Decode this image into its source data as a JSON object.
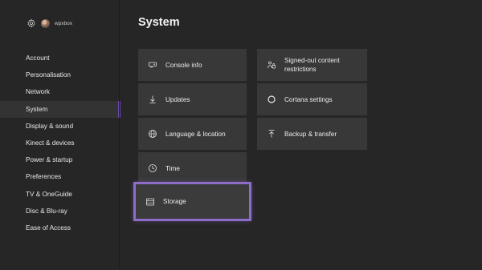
{
  "profile": {
    "gamertag": "wpxbox"
  },
  "nav": {
    "items": [
      {
        "label": "Account"
      },
      {
        "label": "Personalisation"
      },
      {
        "label": "Network"
      },
      {
        "label": "System"
      },
      {
        "label": "Display & sound"
      },
      {
        "label": "Kinect & devices"
      },
      {
        "label": "Power & startup"
      },
      {
        "label": "Preferences"
      },
      {
        "label": "TV & OneGuide"
      },
      {
        "label": "Disc & Blu-ray"
      },
      {
        "label": "Ease of Access"
      }
    ],
    "active": "System"
  },
  "main": {
    "title": "System",
    "tiles": [
      {
        "label": "Console info",
        "icon": "console-icon"
      },
      {
        "label": "Updates",
        "icon": "download-icon"
      },
      {
        "label": "Language & location",
        "icon": "globe-icon"
      },
      {
        "label": "Time",
        "icon": "clock-icon"
      },
      {
        "label": "Storage",
        "icon": "storage-icon"
      },
      {
        "label": "Signed-out content restrictions",
        "icon": "restrictions-icon"
      },
      {
        "label": "Cortana settings",
        "icon": "cortana-icon"
      },
      {
        "label": "Backup & transfer",
        "icon": "upload-icon"
      }
    ],
    "focused": "Storage"
  },
  "colors": {
    "accent": "#8e6cc9",
    "background": "#262626",
    "tile": "#383838"
  }
}
